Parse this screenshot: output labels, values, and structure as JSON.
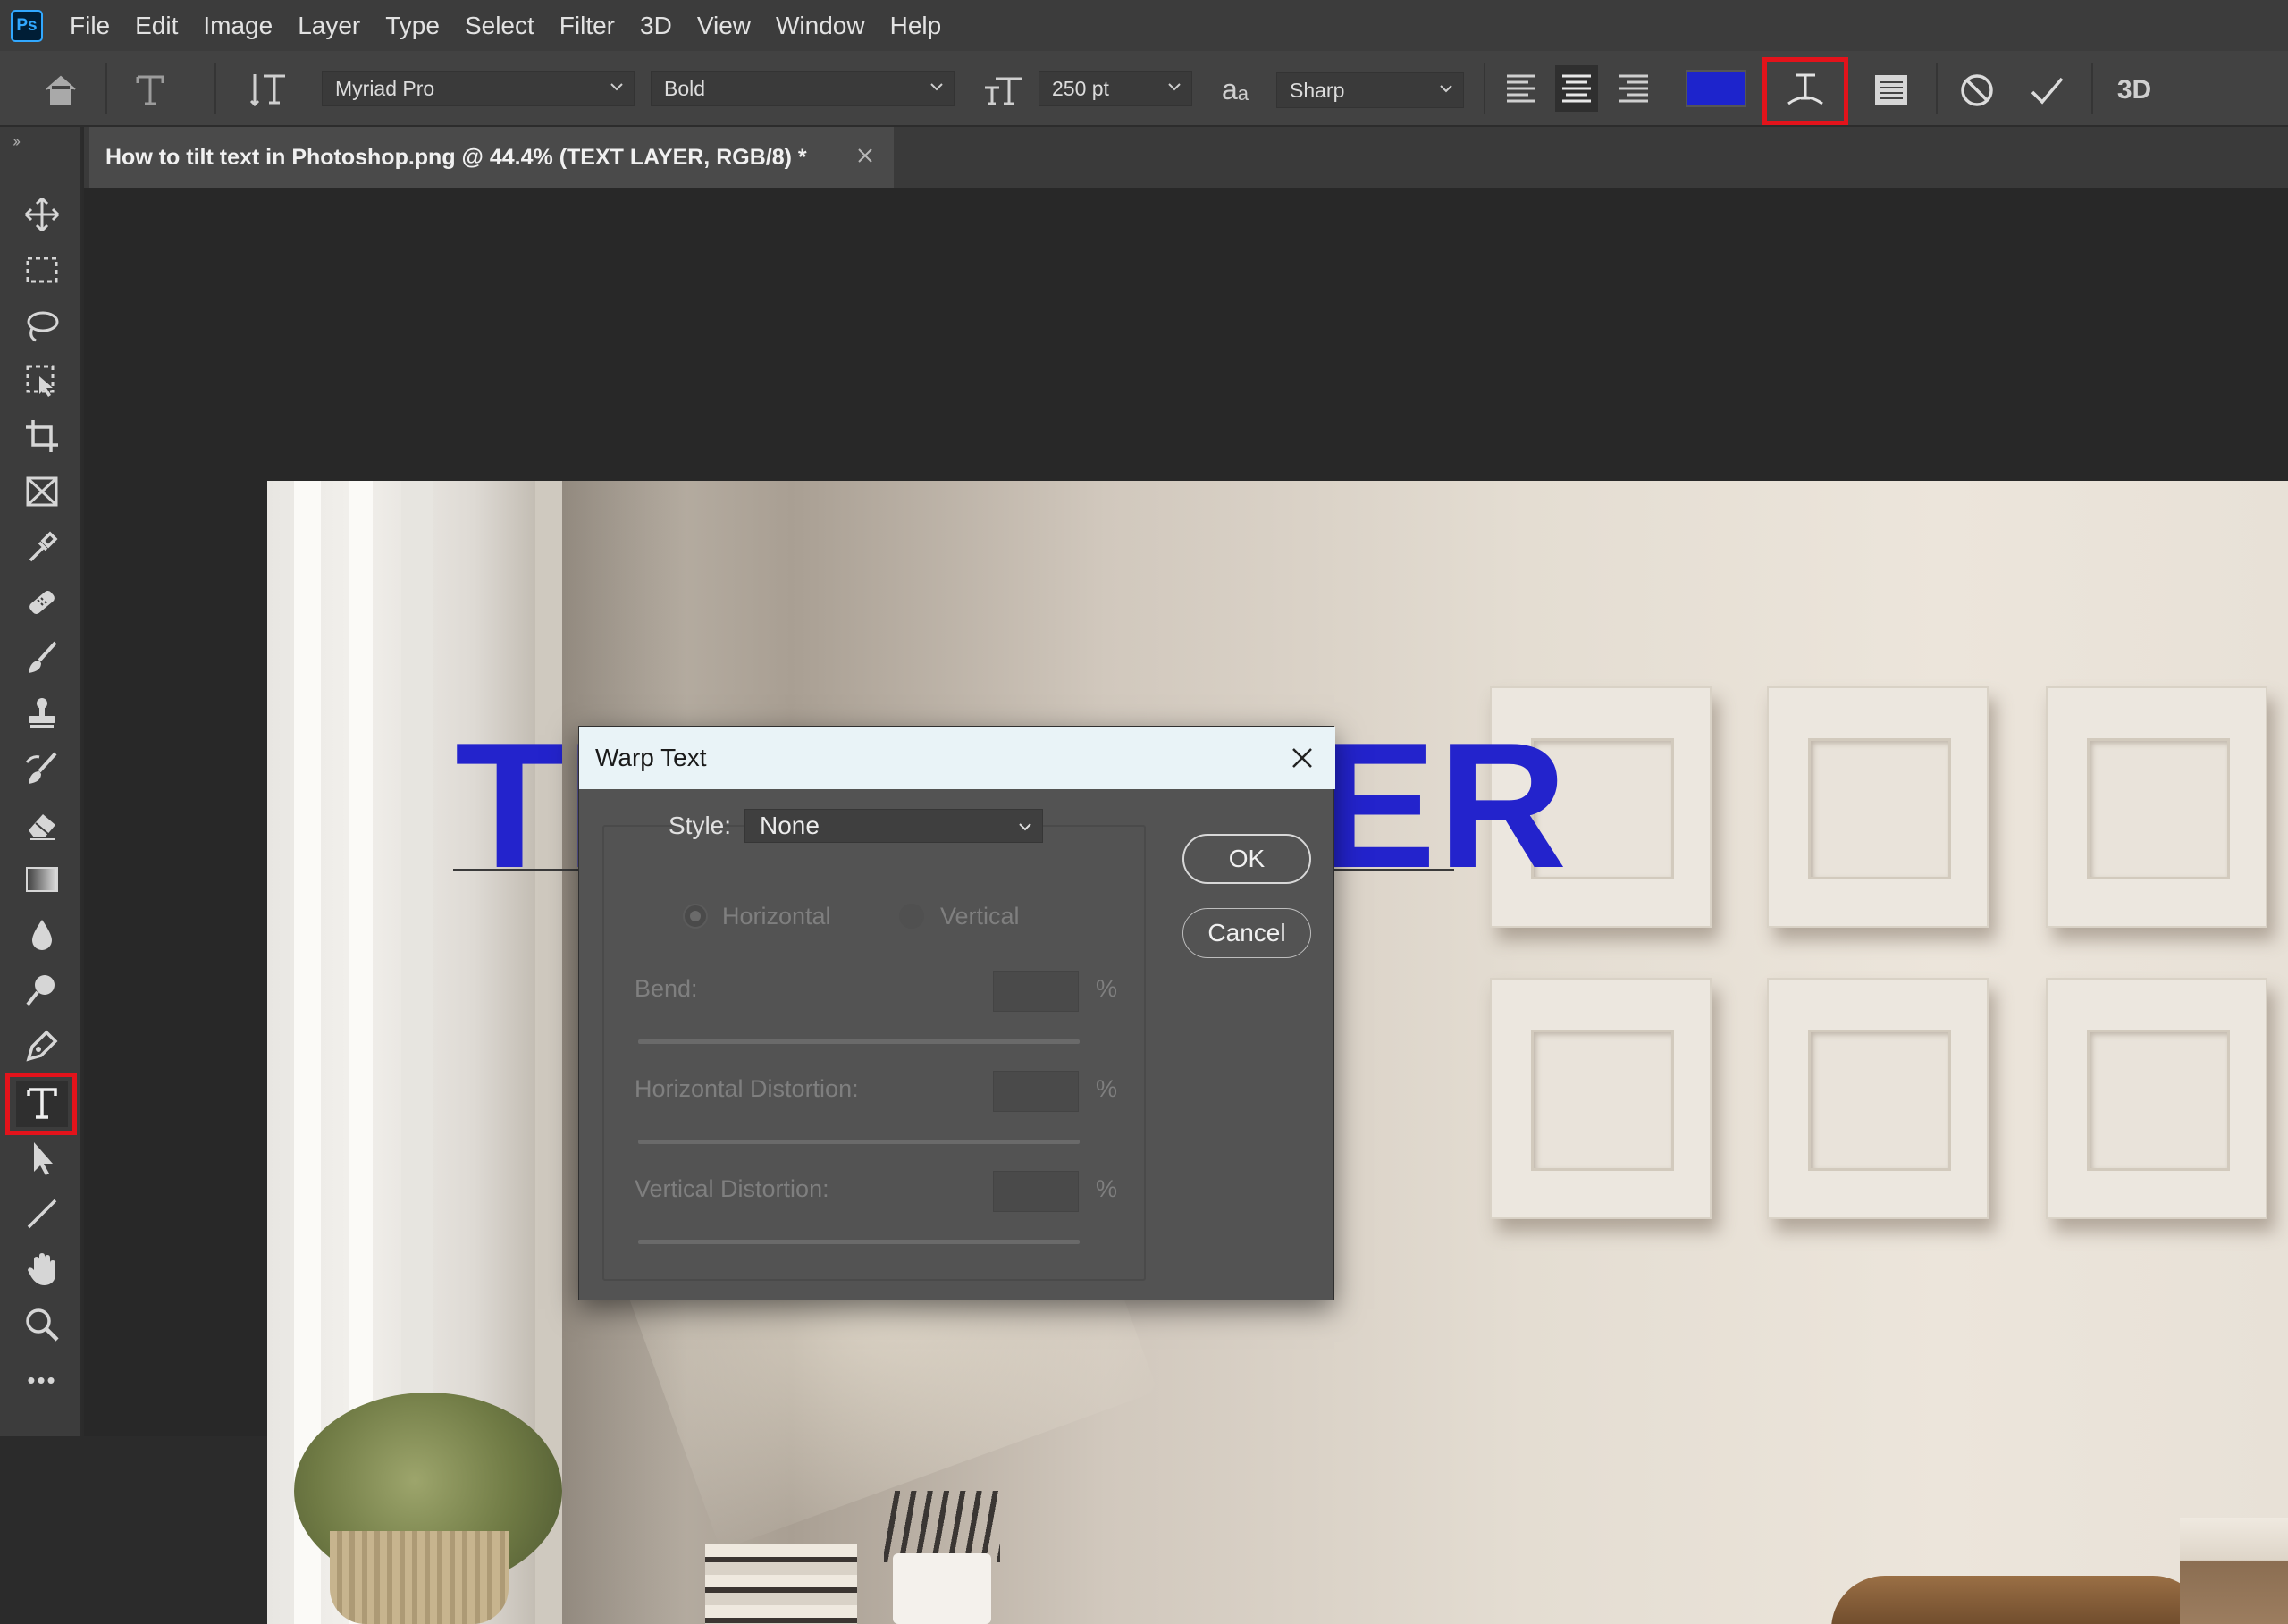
{
  "app": {
    "logo_text": "Ps"
  },
  "menu": [
    "File",
    "Edit",
    "Image",
    "Layer",
    "Type",
    "Select",
    "Filter",
    "3D",
    "View",
    "Window",
    "Help"
  ],
  "options_bar": {
    "font_family": "Myriad Pro",
    "font_style": "Bold",
    "font_size": "250 pt",
    "antialias_icon_text": "a",
    "antialias_icon_text2": "a",
    "antialias": "Sharp",
    "text_color": "#1d24cc",
    "highlight_color": "#e3131b",
    "three_d_label": "3D"
  },
  "document_tab": {
    "title": "How to tilt text in Photoshop.png @ 44.4% (TEXT LAYER, RGB/8) *"
  },
  "canvas": {
    "text_layer": "TEXT LAYER",
    "text_color": "#2323cc"
  },
  "warp_dialog": {
    "title": "Warp Text",
    "style_label": "Style:",
    "style_value": "None",
    "orientation_horizontal": "Horizontal",
    "orientation_vertical": "Vertical",
    "bend_label": "Bend:",
    "horizontal_distortion_label": "Horizontal Distortion:",
    "vertical_distortion_label": "Vertical Distortion:",
    "percent": "%",
    "ok_label": "OK",
    "cancel_label": "Cancel"
  },
  "toolbar": {
    "tools": [
      "move-tool",
      "marquee-tool",
      "lasso-tool",
      "object-selection-tool",
      "crop-tool",
      "frame-tool",
      "eyedropper-tool",
      "healing-brush-tool",
      "brush-tool",
      "clone-stamp-tool",
      "history-brush-tool",
      "eraser-tool",
      "gradient-tool",
      "blur-tool",
      "dodge-tool",
      "pen-tool",
      "type-tool",
      "path-selection-tool",
      "line-tool",
      "hand-tool",
      "zoom-tool",
      "more-tools"
    ],
    "active_tool": "type-tool",
    "more_glyph": "•••"
  }
}
